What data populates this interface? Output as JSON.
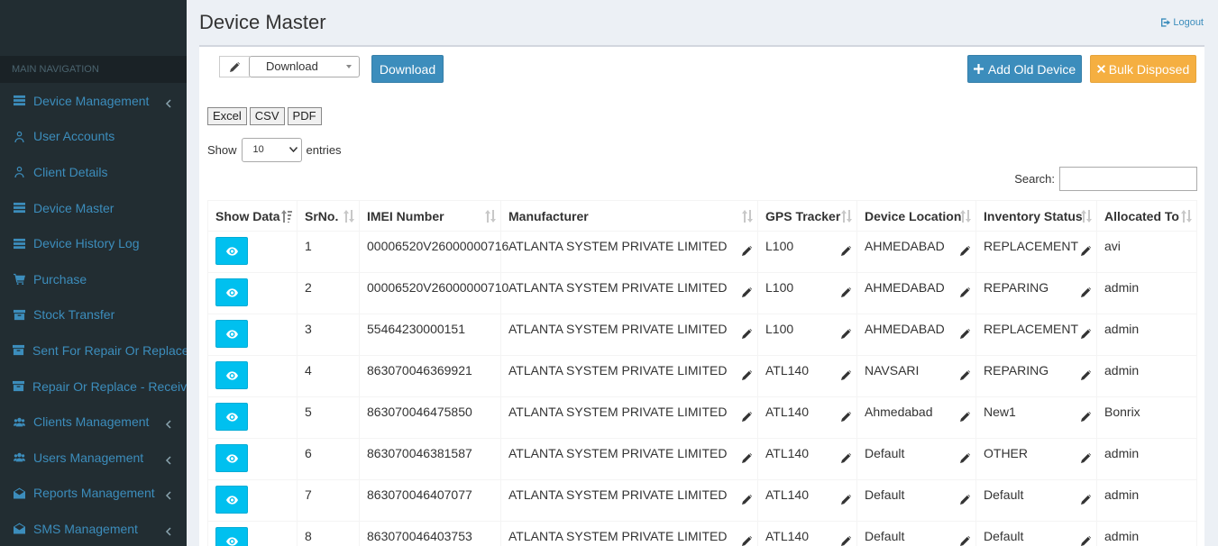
{
  "sidebar": {
    "header": "MAIN NAVIGATION",
    "items": [
      {
        "label": "Device Management",
        "icon": "list-icon",
        "has_chevron": true
      },
      {
        "label": "User Accounts",
        "icon": "user-icon",
        "has_chevron": false
      },
      {
        "label": "Client Details",
        "icon": "user-icon",
        "has_chevron": false
      },
      {
        "label": "Device Master",
        "icon": "list-icon",
        "has_chevron": false
      },
      {
        "label": "Device History Log",
        "icon": "list-icon",
        "has_chevron": false
      },
      {
        "label": "Purchase",
        "icon": "cart-icon",
        "has_chevron": false
      },
      {
        "label": "Stock Transfer",
        "icon": "archive-icon",
        "has_chevron": false
      },
      {
        "label": "Sent For Repair Or Replace",
        "icon": "archive-icon",
        "has_chevron": false
      },
      {
        "label": "Repair Or Replace - Received",
        "icon": "archive-icon",
        "has_chevron": false
      },
      {
        "label": "Clients Management",
        "icon": "users-icon",
        "has_chevron": true
      },
      {
        "label": "Users Management",
        "icon": "users-icon",
        "has_chevron": true
      },
      {
        "label": "Reports Management",
        "icon": "envelope-open-icon",
        "has_chevron": true
      },
      {
        "label": "SMS Management",
        "icon": "envelope-open-icon",
        "has_chevron": true
      }
    ]
  },
  "header": {
    "title": "Device Master",
    "logout_label": "Logout"
  },
  "toolbar": {
    "select_value": "Download",
    "download_label": "Download",
    "add_old_device_label": "Add Old Device",
    "bulk_disposed_label": "Bulk Disposed"
  },
  "export": {
    "excel": "Excel",
    "csv": "CSV",
    "pdf": "PDF"
  },
  "entries": {
    "show_label": "Show",
    "value": "10",
    "entries_label": "entries"
  },
  "search": {
    "label": "Search:",
    "value": ""
  },
  "table": {
    "columns": [
      "Show Data",
      "SrNo.",
      "IMEI Number",
      "Manufacturer",
      "GPS Tracker",
      "Device Location",
      "Inventory Status",
      "Allocated To"
    ],
    "rows": [
      [
        "1",
        "00006520V26000000716",
        "ATLANTA SYSTEM PRIVATE LIMITED",
        "L100",
        "AHMEDABAD",
        "REPLACEMENT",
        "avi"
      ],
      [
        "2",
        "00006520V26000000710",
        "ATLANTA SYSTEM PRIVATE LIMITED",
        "L100",
        "AHMEDABAD",
        "REPARING",
        "admin"
      ],
      [
        "3",
        "55464230000151",
        "ATLANTA SYSTEM PRIVATE LIMITED",
        "L100",
        "AHMEDABAD",
        "REPLACEMENT",
        "admin"
      ],
      [
        "4",
        "863070046369921",
        "ATLANTA SYSTEM PRIVATE LIMITED",
        "ATL140",
        "NAVSARI",
        "REPARING",
        "admin"
      ],
      [
        "5",
        "863070046475850",
        "ATLANTA SYSTEM PRIVATE LIMITED",
        "ATL140",
        "Ahmedabad",
        "New1",
        "Bonrix"
      ],
      [
        "6",
        "863070046381587",
        "ATLANTA SYSTEM PRIVATE LIMITED",
        "ATL140",
        "Default",
        "OTHER",
        "admin"
      ],
      [
        "7",
        "863070046407077",
        "ATLANTA SYSTEM PRIVATE LIMITED",
        "ATL140",
        "Default",
        "Default",
        "admin"
      ],
      [
        "8",
        "863070046403753",
        "ATLANTA SYSTEM PRIVATE LIMITED",
        "ATL140",
        "Default",
        "Default",
        "admin"
      ]
    ]
  },
  "colors": {
    "sidebar_bg": "#222d32",
    "link": "#3c8dbc",
    "primary": "#3c8dbc",
    "warning": "#f39c12",
    "info": "#00c0ef"
  }
}
